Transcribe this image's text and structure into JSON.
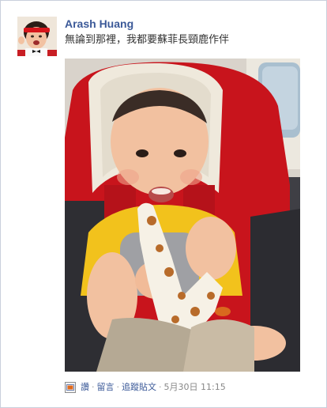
{
  "post": {
    "author": "Arash Huang",
    "message": "無論到那裡，我都要蘇菲長頸鹿作伴",
    "footer": {
      "like_label": "讚",
      "separator": "·",
      "comment_label": "留言",
      "follow_label": "追蹤貼文",
      "timestamp": "5月30日 11:15"
    }
  },
  "icons": {
    "post_type": "photo-post-icon"
  },
  "colors": {
    "link": "#3b5998",
    "text": "#333333",
    "muted": "#888888",
    "border": "#c9cfdc"
  }
}
